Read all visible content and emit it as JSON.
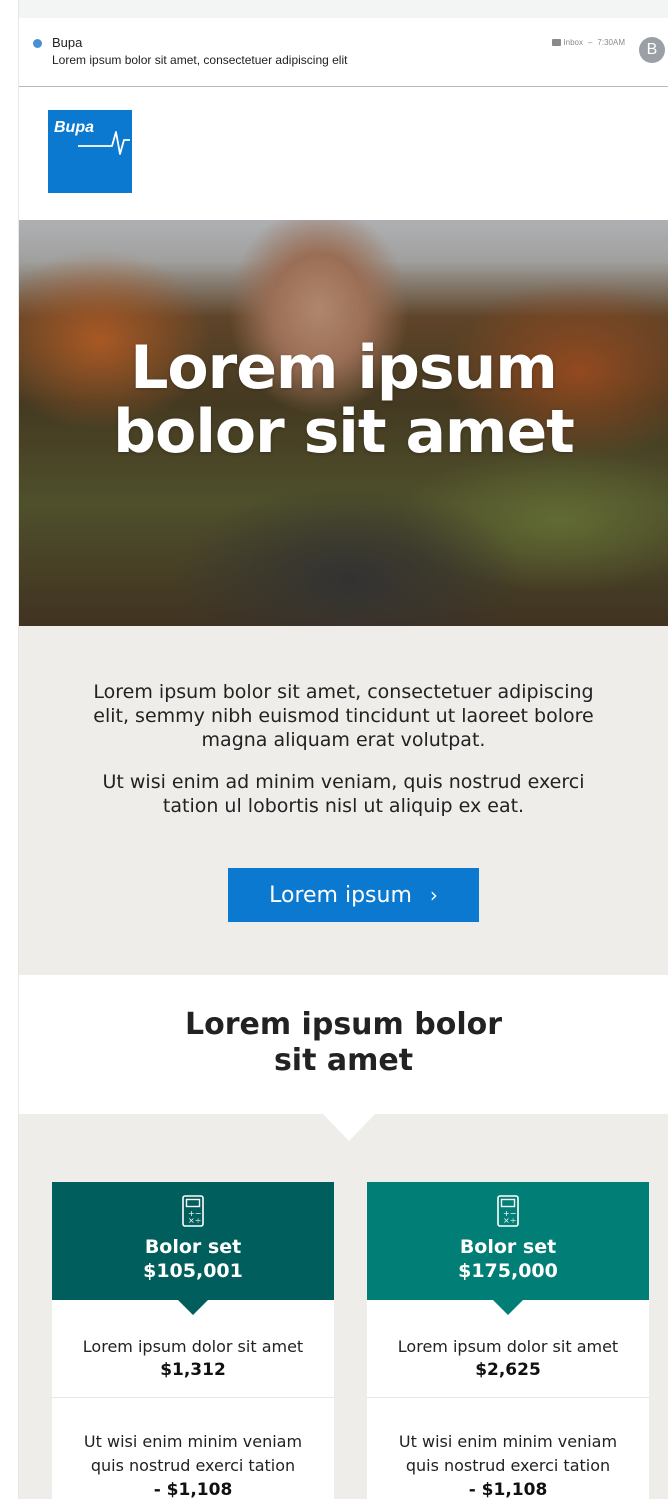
{
  "email": {
    "sender": "Bupa",
    "subject": "Lorem ipsum bolor sit amet, consectetuer adipiscing elit",
    "folder": "Inbox",
    "time": "7:30AM",
    "meta_separator": "–",
    "avatar_initial": "B"
  },
  "brand": {
    "logo_text": "Bupa",
    "color": "#0a79cf"
  },
  "hero": {
    "title_line1": "Lorem ipsum",
    "title_line2": "bolor sit amet"
  },
  "intro": {
    "paragraph1": "Lorem ipsum bolor sit amet, consectetuer adipiscing elit, semmy nibh euismod tincidunt ut laoreet bolore magna aliquam erat volutpat.",
    "paragraph2": "Ut wisi enim ad minim veniam, quis nostrud exerci tation ul lobortis nisl ut aliquip ex eat.",
    "cta_label": "Lorem ipsum",
    "cta_chevron": "›"
  },
  "section": {
    "heading_line1": "Lorem ipsum bolor",
    "heading_line2": "sit amet"
  },
  "cards": [
    {
      "icon": "calculator-icon",
      "title": "Bolor set",
      "amount": "$105,001",
      "color": "#005e5c",
      "row1_label": "Lorem ipsum dolor sit amet",
      "row1_value": "$1,312",
      "row2_label": "Ut wisi enim minim veniam quis nostrud exerci tation",
      "row2_value": "- $1,108"
    },
    {
      "icon": "calculator-icon",
      "title": "Bolor set",
      "amount": "$175,000",
      "color": "#017f76",
      "row1_label": "Lorem ipsum dolor sit amet",
      "row1_value": "$2,625",
      "row2_label": "Ut wisi enim minim veniam quis nostrud exerci tation",
      "row2_value": "- $1,108"
    }
  ]
}
